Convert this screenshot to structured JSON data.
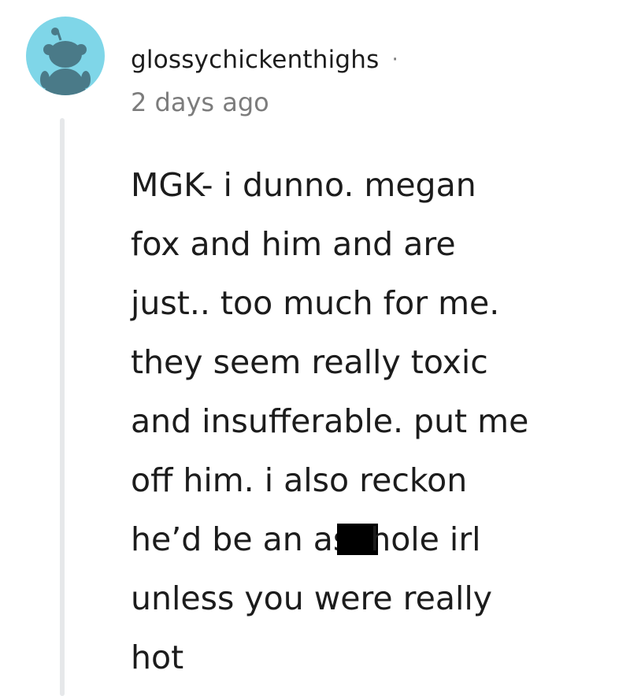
{
  "comment": {
    "author": "glossychickenthighs",
    "separator": "·",
    "timestamp": "2 days ago",
    "avatar_icon": "snoo-avatar-icon",
    "avatar_color": "#7fd6e8",
    "body_lines": [
      "MGK- i dunno. megan",
      "fox and him and are",
      "just.. too much for me.",
      "they seem really toxic",
      "and insufferable. put me",
      "off him. i also reckon",
      "he’d be an as",
      "hole irl",
      "unless you were really",
      "hot"
    ]
  }
}
